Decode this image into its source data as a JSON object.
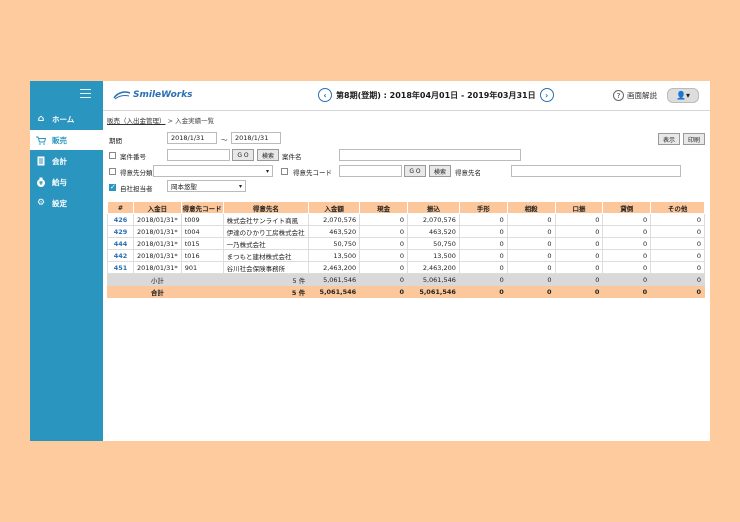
{
  "sidebar": {
    "items": [
      {
        "label": "ホーム",
        "icon": "home-icon"
      },
      {
        "label": "販売",
        "icon": "cart-icon"
      },
      {
        "label": "会計",
        "icon": "ledger-icon"
      },
      {
        "label": "給与",
        "icon": "money-bag-icon"
      },
      {
        "label": "設定",
        "icon": "gear-icon"
      }
    ]
  },
  "header": {
    "logo_text": "SmileWorks",
    "period_text": "第8期(登期) : 2018年04月01日 - 2019年03月31日",
    "help_label": "画面解説"
  },
  "breadcrumb": {
    "parent": "販売（入出金管理）",
    "current": "> 入金実績一覧"
  },
  "filters": {
    "period_label": "期間",
    "date_from": "2018/1/31",
    "tilde": "〜",
    "date_to": "2018/1/31",
    "case_no_label": "案件番号",
    "case_name_label": "案件名",
    "customer_cat_label": "得意先分類",
    "customer_code_label": "得意先コード",
    "customer_name_label": "得意先名",
    "staff_label": "自社担当者",
    "staff_value": "岡本悠聖",
    "go_label": "G O",
    "search_label": "検索",
    "display_label": "表示",
    "print_label": "印刷"
  },
  "table": {
    "headers": [
      "#",
      "入金日",
      "得意先コード",
      "得意先名",
      "入金額",
      "現金",
      "振込",
      "手形",
      "相殺",
      "口振",
      "貸倒",
      "その他"
    ],
    "rows": [
      [
        "426",
        "2018/01/31*",
        "t009",
        "株式会社サンライト商風",
        "2,070,576",
        "0",
        "2,070,576",
        "0",
        "0",
        "0",
        "0",
        "0"
      ],
      [
        "429",
        "2018/01/31*",
        "t004",
        "伊達のひかり工房株式会社",
        "463,520",
        "0",
        "463,520",
        "0",
        "0",
        "0",
        "0",
        "0"
      ],
      [
        "444",
        "2018/01/31*",
        "t015",
        "一乃株式会社",
        "50,750",
        "0",
        "50,750",
        "0",
        "0",
        "0",
        "0",
        "0"
      ],
      [
        "442",
        "2018/01/31*",
        "t016",
        "まつもと建材株式会社",
        "13,500",
        "0",
        "13,500",
        "0",
        "0",
        "0",
        "0",
        "0"
      ],
      [
        "451",
        "2018/01/31*",
        "901",
        "谷川社会保険事務所",
        "2,463,200",
        "0",
        "2,463,200",
        "0",
        "0",
        "0",
        "0",
        "0"
      ]
    ],
    "subtotal": {
      "label": "小計",
      "count": "5 件",
      "values": [
        "5,061,546",
        "0",
        "5,061,546",
        "0",
        "0",
        "0",
        "0",
        "0"
      ]
    },
    "total": {
      "label": "合計",
      "count": "5 件",
      "values": [
        "5,061,546",
        "0",
        "5,061,546",
        "0",
        "0",
        "0",
        "0",
        "0"
      ]
    }
  },
  "colors": {
    "sidebar": "#2a95bf",
    "table_header": "#fcc79b",
    "background": "#fecb9f",
    "accent": "#2a6fb3"
  }
}
